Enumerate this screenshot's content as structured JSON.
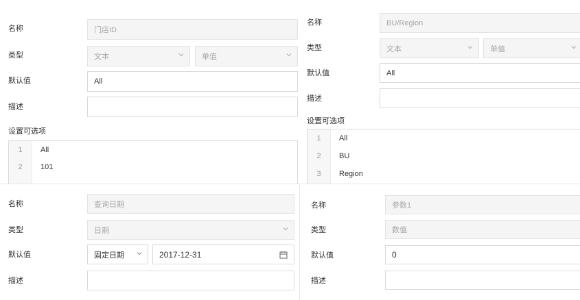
{
  "panel_store": {
    "name_label": "名称",
    "name_value": "门店ID",
    "type_label": "类型",
    "type_value": "文本",
    "mode_value": "单值",
    "default_label": "默认值",
    "default_value": "All",
    "desc_label": "描述",
    "desc_value": "",
    "options_label": "设置可选项",
    "options": [
      {
        "num": "1",
        "text": "All"
      },
      {
        "num": "2",
        "text": "101"
      }
    ]
  },
  "panel_bu": {
    "name_label": "名称",
    "name_value": "BU/Region",
    "type_label": "类型",
    "type_value": "文本",
    "mode_value": "单值",
    "default_label": "默认值",
    "default_value": "All",
    "desc_label": "描述",
    "desc_value": "",
    "options_label": "设置可选项",
    "options": [
      {
        "num": "1",
        "text": "All"
      },
      {
        "num": "2",
        "text": "BU"
      },
      {
        "num": "3",
        "text": "Region"
      }
    ]
  },
  "panel_date": {
    "name_label": "名称",
    "name_value": "查询日期",
    "type_label": "类型",
    "type_value": "日期",
    "default_label": "默认值",
    "default_mode": "固定日期",
    "default_value": "2017-12-31",
    "desc_label": "描述",
    "desc_value": ""
  },
  "panel_param": {
    "name_label": "名称",
    "name_value": "参数1",
    "type_label": "类型",
    "type_value": "数值",
    "default_label": "默认值",
    "default_value": "0",
    "desc_label": "描述",
    "desc_value": ""
  },
  "icons": {
    "chevron": "chevron-down-icon",
    "calendar": "calendar-icon"
  },
  "colors": {
    "border": "#d9d9d9",
    "disabled_bg": "#f5f5f5",
    "disabled_text": "#a8a8a8",
    "text": "#333333",
    "gutter_bg": "#f7f7f7"
  }
}
